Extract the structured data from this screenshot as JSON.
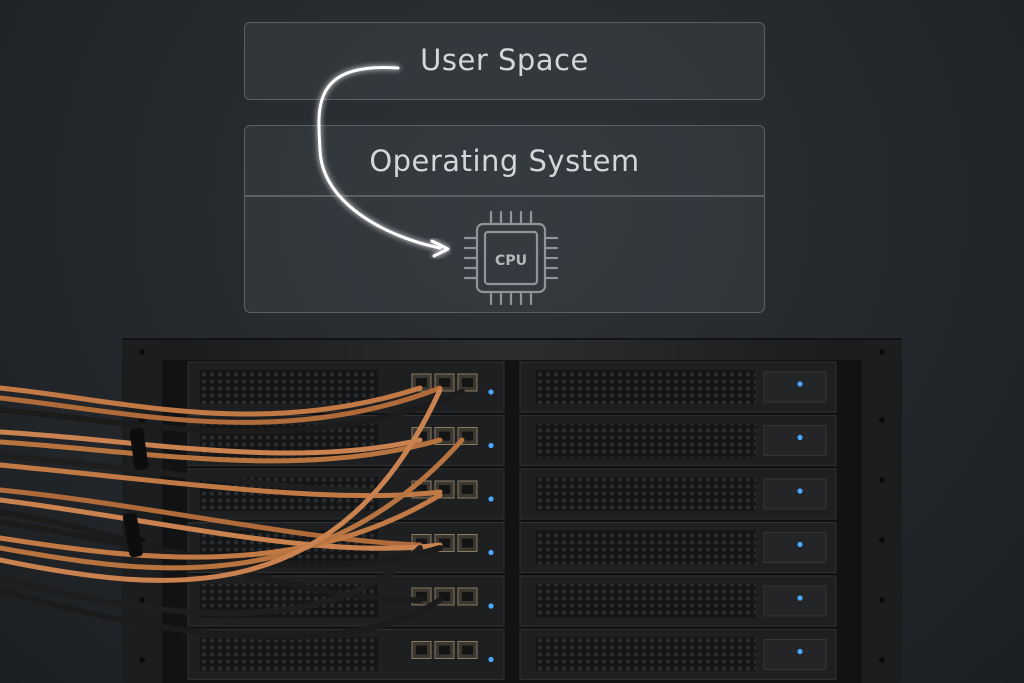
{
  "layers": {
    "user_space": "User Space",
    "operating_system": "Operating System",
    "cpu_label": "CPU"
  },
  "colors": {
    "accent_led": "#4aa8ff",
    "cable_copper": "#c17a45",
    "cable_black": "#1b1b1b",
    "arrow_glow": "#ffffff"
  },
  "rack": {
    "units": 6
  }
}
